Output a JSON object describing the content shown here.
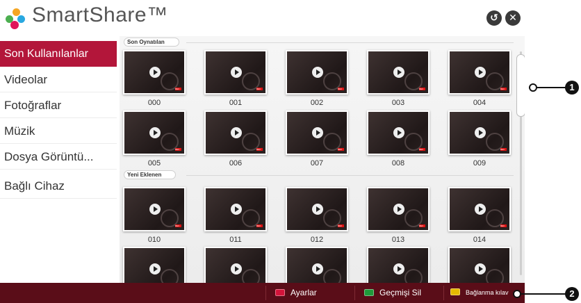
{
  "header": {
    "title": "SmartShare™",
    "back_icon": "↺",
    "close_icon": "✕"
  },
  "sidebar": {
    "items": [
      {
        "label": "Son Kullanılanlar"
      },
      {
        "label": "Videolar"
      },
      {
        "label": "Fotoğraflar"
      },
      {
        "label": "Müzik"
      },
      {
        "label": "Dosya Görüntü..."
      },
      {
        "label": "Bağlı Cihaz"
      }
    ]
  },
  "sections": [
    {
      "label": "Son Oynatılan",
      "items": [
        "000",
        "001",
        "002",
        "003",
        "004",
        "005",
        "006",
        "007",
        "008",
        "009"
      ]
    },
    {
      "label": "Yeni Eklenen",
      "items": [
        "010",
        "011",
        "012",
        "013",
        "014"
      ]
    }
  ],
  "thumb_badge": "REC",
  "footer": {
    "buttons": [
      {
        "label": "Ayarlar",
        "color": "#d4143a"
      },
      {
        "label": "Geçmişi Sil",
        "color": "#1f9a3a"
      },
      {
        "label": "Bağlanma kılav",
        "color": "#e6b800"
      }
    ]
  },
  "callouts": [
    "1",
    "2"
  ],
  "colors": {
    "accent": "#b3163a",
    "footer_bg": "#5a0d18"
  }
}
